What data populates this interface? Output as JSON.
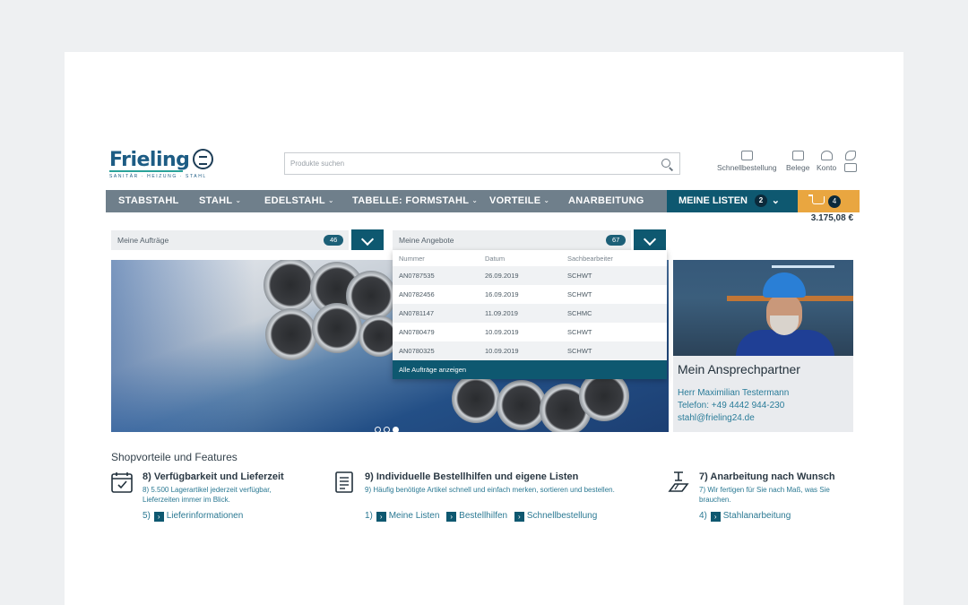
{
  "logo": {
    "name": "Frieling",
    "tagline": "SANITÄR · HEIZUNG · STAHL"
  },
  "search": {
    "placeholder": "Produkte suchen"
  },
  "toplinks": [
    {
      "label": "Schnellbestellung",
      "icon": "clipboard-icon"
    },
    {
      "label": "Belege",
      "icon": "folder-icon"
    },
    {
      "label": "Konto",
      "icon": "user-icon"
    },
    {
      "label": "",
      "icon": "phone-mail-icon"
    }
  ],
  "nav": {
    "items": [
      {
        "label": "STABSTAHL",
        "dropdown": false
      },
      {
        "label": "STAHL",
        "dropdown": true
      },
      {
        "label": "EDELSTAHL",
        "dropdown": true
      },
      {
        "label": "TABELLE: FORMSTAHL",
        "dropdown": true
      },
      {
        "label": "VORTEILE",
        "dropdown": true
      },
      {
        "label": "ANARBEITUNG",
        "dropdown": false
      }
    ],
    "lists_label": "MEINE LISTEN",
    "lists_count": "2",
    "cart_count": "4",
    "cart_total": "3.175,08 €"
  },
  "orders": {
    "label": "Meine Aufträge",
    "count": "46"
  },
  "offers": {
    "label": "Meine Angebote",
    "count": "67",
    "columns": [
      "Nummer",
      "Datum",
      "Sachbearbeiter"
    ],
    "rows": [
      [
        "AN0787535",
        "26.09.2019",
        "SCHWT"
      ],
      [
        "AN0782456",
        "16.09.2019",
        "SCHWT"
      ],
      [
        "AN0781147",
        "11.09.2019",
        "SCHMC"
      ],
      [
        "AN0780479",
        "10.09.2019",
        "SCHWT"
      ],
      [
        "AN0780325",
        "10.09.2019",
        "SCHWT"
      ]
    ],
    "footer": "Alle Aufträge anzeigen"
  },
  "carousel": {
    "slides": 3,
    "active": 3
  },
  "contact": {
    "title": "Mein Ansprechpartner",
    "name": "Herr Maximilian Testermann",
    "phone": "Telefon: +49 4442 944-230",
    "email": "stahl@frieling24.de"
  },
  "features": {
    "heading": "Shopvorteile und Features",
    "items": [
      {
        "icon": "calendar-check-icon",
        "title": "8) Verfügbarkeit und Lieferzeit",
        "desc": "8) 5.500 Lagerartikel jederzeit verfügbar, Lieferzeiten immer im Blick.",
        "prefix": "5)",
        "links": [
          "Lieferinformationen"
        ]
      },
      {
        "icon": "document-list-icon",
        "title": "9) Individuelle Bestellhilfen und eigene Listen",
        "desc": "9) Häufig benötigte Artikel schnell und einfach merken, sortieren und bestellen.",
        "prefix": "1)",
        "links": [
          "Meine Listen",
          "Bestellhilfen",
          "Schnellbestellung"
        ]
      },
      {
        "icon": "beam-processing-icon",
        "title": "7) Anarbeitung nach Wunsch",
        "desc": "7) Wir fertigen für Sie nach Maß, was Sie brauchen.",
        "prefix": "4)",
        "links": [
          "Stahlanarbeitung"
        ]
      }
    ]
  },
  "colors": {
    "primary": "#0e5870",
    "nav": "#6f7f8b",
    "cart": "#e9a640",
    "link": "#2b7993"
  }
}
